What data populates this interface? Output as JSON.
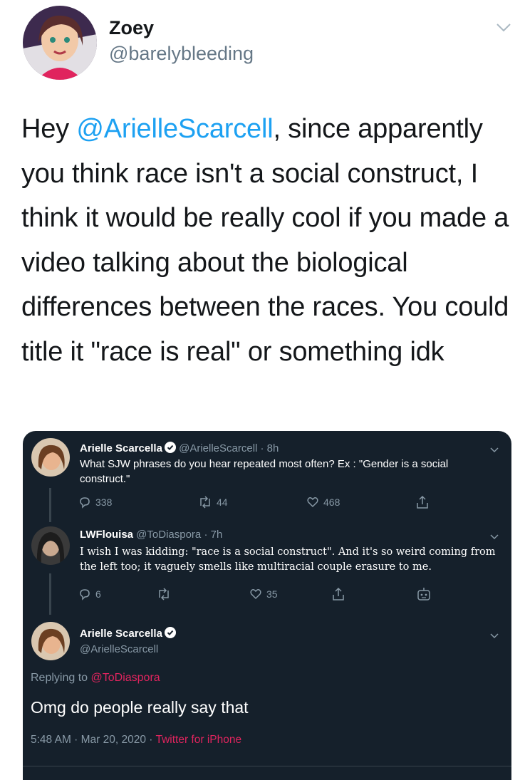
{
  "tweet": {
    "display_name": "Zoey",
    "handle": "@barelybleeding",
    "text_before": "Hey ",
    "mention": "@ArielleScarcell",
    "text_after": ", since apparently you think race isn't a social construct, I think it would be really cool if you made a video talking about the biological differences between the races. You could title it \"race is real\" or something idk",
    "icons": [
      "avatar",
      "chevron-down-icon"
    ]
  },
  "embed": {
    "tweet1": {
      "name": "Arielle Scarcella",
      "handle_time": "@ArielleScarcell · 8h",
      "text": "What SJW phrases do you hear repeated most often? Ex : \"Gender is a social construct.\"",
      "replies": "338",
      "retweets": "44",
      "likes": "468"
    },
    "tweet2": {
      "name": "LWFlouisa",
      "handle_time": "@ToDiaspora · 7h",
      "text": "I wish I was kidding: \"race is a social construct\". And it's so weird coming from the left too; it vaguely smells like multiracial couple erasure to me.",
      "replies": "6",
      "retweets": "",
      "likes": "35"
    },
    "tweet3": {
      "name": "Arielle Scarcella",
      "handle": "@ArielleScarcell",
      "replying_prefix": "Replying to ",
      "replying_to": "@ToDiaspora",
      "text": "Omg do people really say that",
      "time": "5:48 AM · Mar 20, 2020 · ",
      "source": "Twitter for iPhone"
    },
    "colors": {
      "background": "#15202b",
      "link": "#e0245e",
      "muted": "#8899a6"
    }
  }
}
